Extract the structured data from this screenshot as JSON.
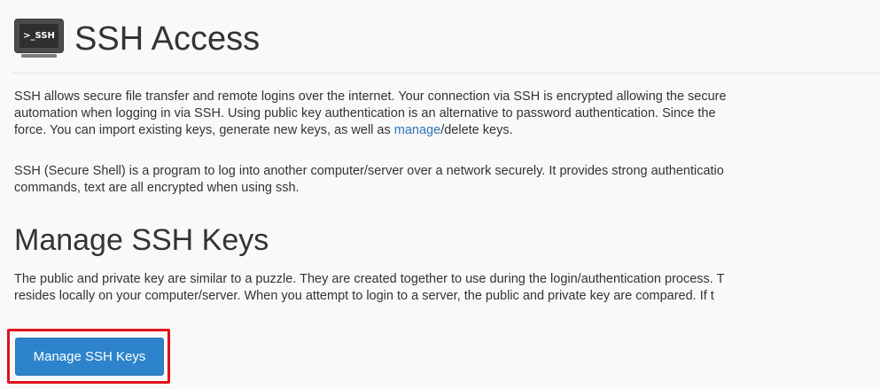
{
  "header": {
    "icon_text": ">_SSH",
    "title": "SSH Access"
  },
  "intro": {
    "line1": "SSH allows secure file transfer and remote logins over the internet. Your connection via SSH is encrypted allowing the secure",
    "line2": "automation when logging in via SSH. Using public key authentication is an alternative to password authentication. Since the",
    "line3_before": "force. You can import existing keys, generate new keys, as well as ",
    "line3_link": "manage",
    "line3_after": "/delete keys."
  },
  "about": {
    "line1": "SSH (Secure Shell) is a program to log into another computer/server over a network securely. It provides strong authenticatio",
    "line2": "commands, text are all encrypted when using ssh."
  },
  "manage_section": {
    "title": "Manage SSH Keys",
    "line1": "The public and private key are similar to a puzzle. They are created together to use during the login/authentication process. T",
    "line2": "resides locally on your computer/server. When you attempt to login to a server, the public and private key are compared. If t",
    "button_label": "Manage SSH Keys"
  },
  "colors": {
    "link": "#2f73b7",
    "primary_button": "#2d84cc",
    "highlight": "#e0101a",
    "background": "#f9f9f9"
  },
  "icons": {
    "header_icon": "terminal-icon"
  }
}
